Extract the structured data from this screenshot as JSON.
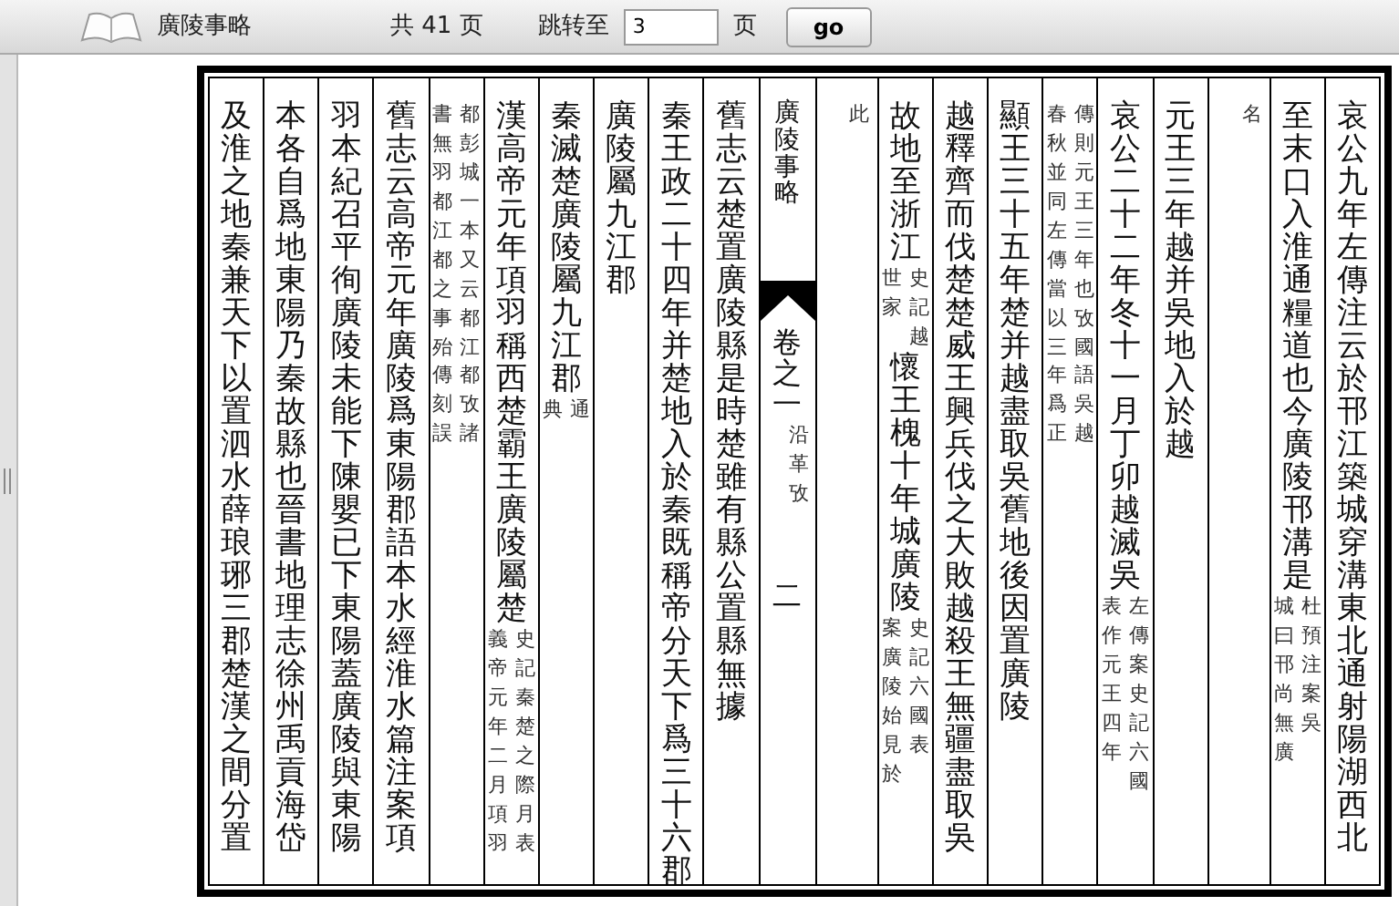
{
  "toolbar": {
    "title": "廣陵事略",
    "total_pages": "共 41 页",
    "goto_label": "跳转至",
    "page_value": "3",
    "page_unit": "页",
    "go_button": "go"
  },
  "page": {
    "columns": [
      {
        "kind": "text",
        "segments": [
          {
            "kind": "main",
            "text": "及淮之地秦兼天下以置泗水薛琅琊三郡楚漢之間分置"
          }
        ]
      },
      {
        "kind": "text",
        "segments": [
          {
            "kind": "main",
            "text": "本各自爲地東陽乃秦故縣也晉書地理志徐州禹貢海岱"
          }
        ]
      },
      {
        "kind": "text",
        "segments": [
          {
            "kind": "main",
            "text": "羽本紀召平徇廣陵未能下陳嬰已下東陽蓋廣陵與東陽"
          }
        ]
      },
      {
        "kind": "text",
        "segments": [
          {
            "kind": "main",
            "text": "舊志云高帝元年廣陵爲東陽郡語本水經淮水篇注案項"
          }
        ]
      },
      {
        "kind": "text",
        "segments": [
          {
            "kind": "note",
            "lines": [
              "書無羽都江都之事殆傳刻誤",
              "都彭城一本又云都江都攷諸"
            ]
          }
        ]
      },
      {
        "kind": "text",
        "segments": [
          {
            "kind": "main",
            "text": "漢高帝元年項羽稱西楚霸王廣陵屬楚"
          },
          {
            "kind": "note",
            "lines": [
              "義帝元年二月項羽",
              "史記秦楚之際月表"
            ]
          }
        ]
      },
      {
        "kind": "text",
        "segments": [
          {
            "kind": "main",
            "text": "秦滅楚廣陵屬九江郡"
          },
          {
            "kind": "note",
            "lines": [
              "典",
              "通"
            ]
          }
        ]
      },
      {
        "kind": "text",
        "segments": [
          {
            "kind": "main",
            "text": "廣陵屬九江郡"
          }
        ]
      },
      {
        "kind": "text",
        "segments": [
          {
            "kind": "main",
            "text": "秦王政二十四年并楚地入於秦既稱帝分天下爲三十六郡"
          }
        ]
      },
      {
        "kind": "text",
        "segments": [
          {
            "kind": "main",
            "text": "舊志云楚置廣陵縣是時楚雖有縣公置縣無據"
          }
        ]
      },
      {
        "kind": "center",
        "book_title": "廣陵事略",
        "volume": "卷之一",
        "section": "沿革攷",
        "page_no": "二"
      },
      {
        "kind": "text",
        "segments": [
          {
            "kind": "note",
            "lines": [
              "此"
            ]
          }
        ]
      },
      {
        "kind": "text",
        "segments": [
          {
            "kind": "main",
            "text": "故地至浙江"
          },
          {
            "kind": "note",
            "lines": [
              "世家",
              "史記越"
            ]
          },
          {
            "kind": "main",
            "text": "懷王槐十年城廣陵"
          },
          {
            "kind": "note",
            "lines": [
              "案廣陵始見於",
              "史記六國表"
            ]
          }
        ]
      },
      {
        "kind": "text",
        "segments": [
          {
            "kind": "main",
            "text": "越釋齊而伐楚楚威王興兵伐之大敗越殺王無疆盡取吳"
          }
        ]
      },
      {
        "kind": "text",
        "segments": [
          {
            "kind": "main",
            "text": "顯王三十五年楚并越盡取吳舊地後因置廣陵"
          }
        ]
      },
      {
        "kind": "text",
        "segments": [
          {
            "kind": "note",
            "lines": [
              "春秋並同左傳當以三年爲正",
              "傳則元王三年也攷國語吳越"
            ]
          }
        ]
      },
      {
        "kind": "text",
        "segments": [
          {
            "kind": "main",
            "text": "哀公二十二年冬十一月丁卯越滅吳"
          },
          {
            "kind": "note",
            "lines": [
              "表作元王四年",
              "左傳案史記六國"
            ]
          }
        ]
      },
      {
        "kind": "text",
        "segments": [
          {
            "kind": "main",
            "text": "元王三年越并吳地入於越"
          }
        ]
      },
      {
        "kind": "text",
        "segments": [
          {
            "kind": "note",
            "lines": [
              "名"
            ]
          }
        ]
      },
      {
        "kind": "text",
        "segments": [
          {
            "kind": "main",
            "text": "至末口入淮通糧道也今廣陵邗溝是"
          },
          {
            "kind": "note",
            "lines": [
              "城曰邗尚無廣",
              "杜預注案吳"
            ]
          }
        ]
      },
      {
        "kind": "text",
        "segments": [
          {
            "kind": "main",
            "text": "哀公九年左傳注云於邗江築城穿溝東北通射陽湖西北"
          }
        ]
      }
    ]
  }
}
